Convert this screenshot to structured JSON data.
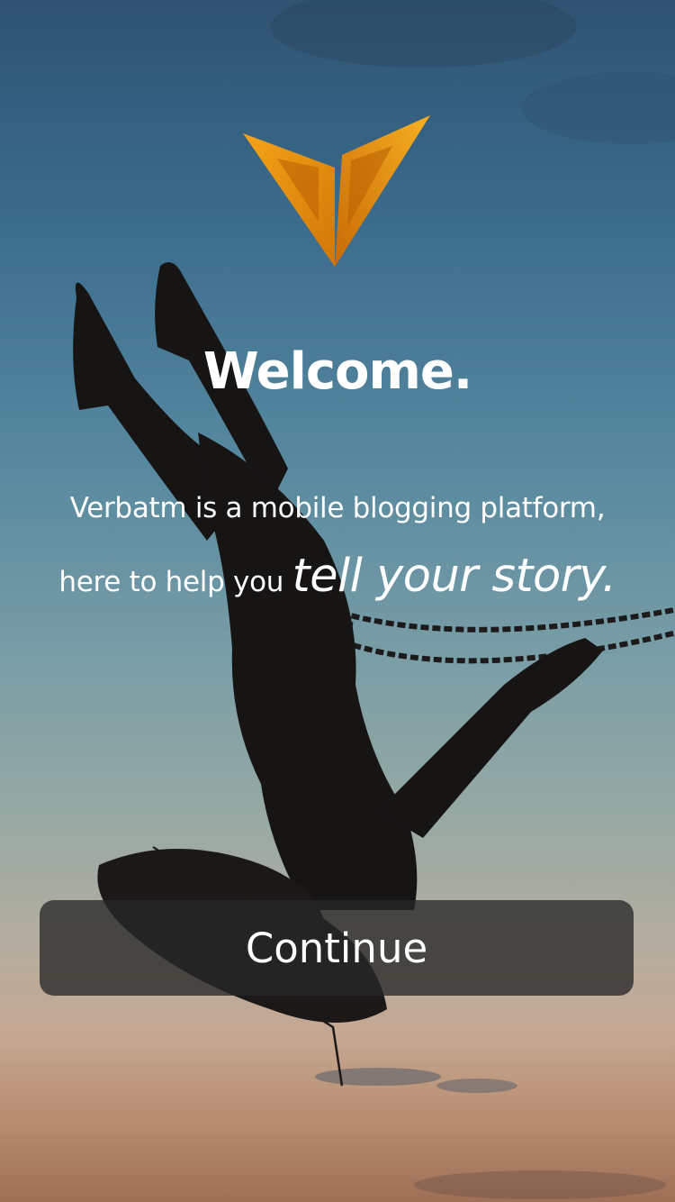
{
  "welcome": {
    "title": "Welcome.",
    "intro_line_1": "Verbatm is a mobile blogging platform,",
    "intro_line_2_prefix": "here to help you ",
    "intro_line_2_emphasis": "tell your story."
  },
  "actions": {
    "continue_label": "Continue"
  },
  "logo": {
    "icon": "verbatm-v-logo",
    "color_primary": "#e8930f",
    "color_dark": "#c66a06"
  },
  "background": {
    "description_icon": "swing-silhouette-photo"
  }
}
